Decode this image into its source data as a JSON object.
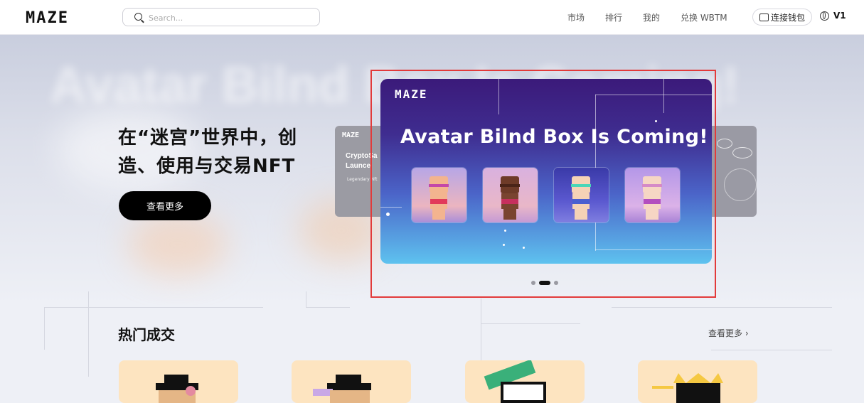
{
  "header": {
    "logo": "MAZE",
    "search_placeholder": "Search...",
    "nav": [
      "市场",
      "排行",
      "我的",
      "兑换 WBTM"
    ],
    "wallet_label": "连接钱包",
    "version": "V1"
  },
  "hero": {
    "background_text": "Avatar Bilnd Box Is Coming!",
    "title_line1": "在“迷宫”世界中，创",
    "title_line2": "造、使用与交易NFT",
    "cta_label": "查看更多"
  },
  "carousel": {
    "left_card": {
      "logo": "MAZE",
      "title_line1": "CryptoSa",
      "title_line2": "Launce",
      "subtitle": "Legendary Nft"
    },
    "banner": {
      "logo": "MAZE",
      "title": "Avatar Bilnd Box Is Coming!"
    },
    "active_index": 1,
    "dot_count": 3
  },
  "hot": {
    "title": "热门成交",
    "more_label": "查看更多 ›"
  },
  "colors": {
    "accent": "#000000",
    "highlight": "#e23a3a",
    "card_bg": "#fde4c0"
  }
}
